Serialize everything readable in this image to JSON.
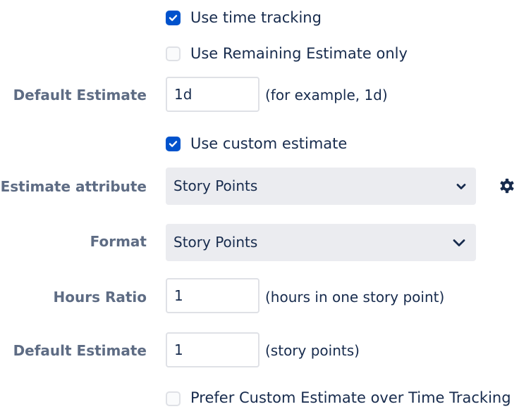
{
  "checkboxes": {
    "use_time_tracking": {
      "label": "Use time tracking",
      "checked": true
    },
    "use_remaining_only": {
      "label": "Use Remaining Estimate only",
      "checked": false
    },
    "use_custom_estimate": {
      "label": "Use custom estimate",
      "checked": true
    },
    "prefer_custom": {
      "label": "Prefer Custom Estimate over Time Tracking",
      "checked": false
    }
  },
  "default_estimate": {
    "label": "Default Estimate",
    "value": "1d",
    "hint": "(for example, 1d)"
  },
  "estimate_attribute": {
    "label": "Estimate attribute",
    "value": "Story Points",
    "settings_icon": "gear-icon"
  },
  "format": {
    "label": "Format",
    "value": "Story Points"
  },
  "hours_ratio": {
    "label": "Hours Ratio",
    "value": "1",
    "hint": "(hours in one story point)"
  },
  "default_estimate_sp": {
    "label": "Default Estimate",
    "value": "1",
    "hint": "(story points)"
  },
  "colors": {
    "accent": "#0052cc",
    "label": "#5e6c84",
    "text": "#172b4d",
    "select_bg": "#ebecf0",
    "border": "#dfe1e6"
  }
}
